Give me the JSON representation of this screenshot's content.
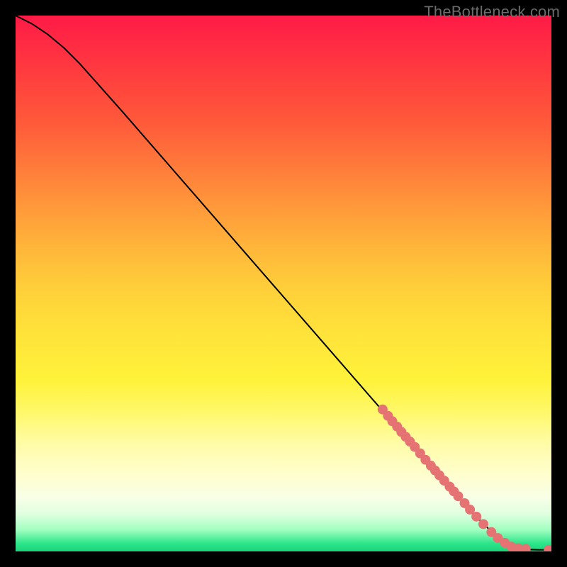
{
  "watermark": "TheBottleneck.com",
  "chart_data": {
    "type": "line",
    "title": "",
    "xlabel": "",
    "ylabel": "",
    "xlim": [
      0,
      100
    ],
    "ylim": [
      0,
      100
    ],
    "grid": false,
    "legend": false,
    "background_gradient": {
      "direction": "vertical",
      "top_color": "#ff1a47",
      "mid_color": "#ffe43a",
      "bottom_color": "#1bd47a"
    },
    "curve": [
      {
        "x": 0,
        "y": 100
      },
      {
        "x": 3,
        "y": 98.5
      },
      {
        "x": 6,
        "y": 96.5
      },
      {
        "x": 9,
        "y": 94
      },
      {
        "x": 12,
        "y": 91
      },
      {
        "x": 20,
        "y": 82
      },
      {
        "x": 30,
        "y": 70.5
      },
      {
        "x": 40,
        "y": 59
      },
      {
        "x": 50,
        "y": 47.5
      },
      {
        "x": 60,
        "y": 36
      },
      {
        "x": 70,
        "y": 24.5
      },
      {
        "x": 80,
        "y": 13
      },
      {
        "x": 85,
        "y": 7.5
      },
      {
        "x": 90,
        "y": 2.5
      },
      {
        "x": 92,
        "y": 1.3
      },
      {
        "x": 94,
        "y": 0.6
      },
      {
        "x": 96,
        "y": 0.35
      },
      {
        "x": 97.5,
        "y": 0.3
      },
      {
        "x": 100,
        "y": 0.3
      }
    ],
    "markers": {
      "color": "#e57373",
      "radius_px": 7,
      "points": [
        {
          "x": 68.5,
          "y": 26.5
        },
        {
          "x": 69.5,
          "y": 25.3
        },
        {
          "x": 70.3,
          "y": 24.3
        },
        {
          "x": 71.2,
          "y": 23.3
        },
        {
          "x": 72.0,
          "y": 22.3
        },
        {
          "x": 72.8,
          "y": 21.4
        },
        {
          "x": 73.6,
          "y": 20.5
        },
        {
          "x": 74.5,
          "y": 19.5
        },
        {
          "x": 75.5,
          "y": 18.3
        },
        {
          "x": 76.5,
          "y": 17.1
        },
        {
          "x": 77.5,
          "y": 16.0
        },
        {
          "x": 78.3,
          "y": 15.1
        },
        {
          "x": 79.1,
          "y": 14.2
        },
        {
          "x": 80.0,
          "y": 13.2
        },
        {
          "x": 81.0,
          "y": 12.1
        },
        {
          "x": 81.8,
          "y": 11.2
        },
        {
          "x": 82.6,
          "y": 10.3
        },
        {
          "x": 83.8,
          "y": 9.0
        },
        {
          "x": 84.8,
          "y": 7.8
        },
        {
          "x": 86.0,
          "y": 6.5
        },
        {
          "x": 87.3,
          "y": 5.1
        },
        {
          "x": 88.8,
          "y": 3.6
        },
        {
          "x": 90.0,
          "y": 2.5
        },
        {
          "x": 91.3,
          "y": 1.6
        },
        {
          "x": 92.5,
          "y": 0.9
        },
        {
          "x": 93.8,
          "y": 0.6
        },
        {
          "x": 95.2,
          "y": 0.45
        },
        {
          "x": 99.5,
          "y": 0.3
        }
      ]
    }
  }
}
